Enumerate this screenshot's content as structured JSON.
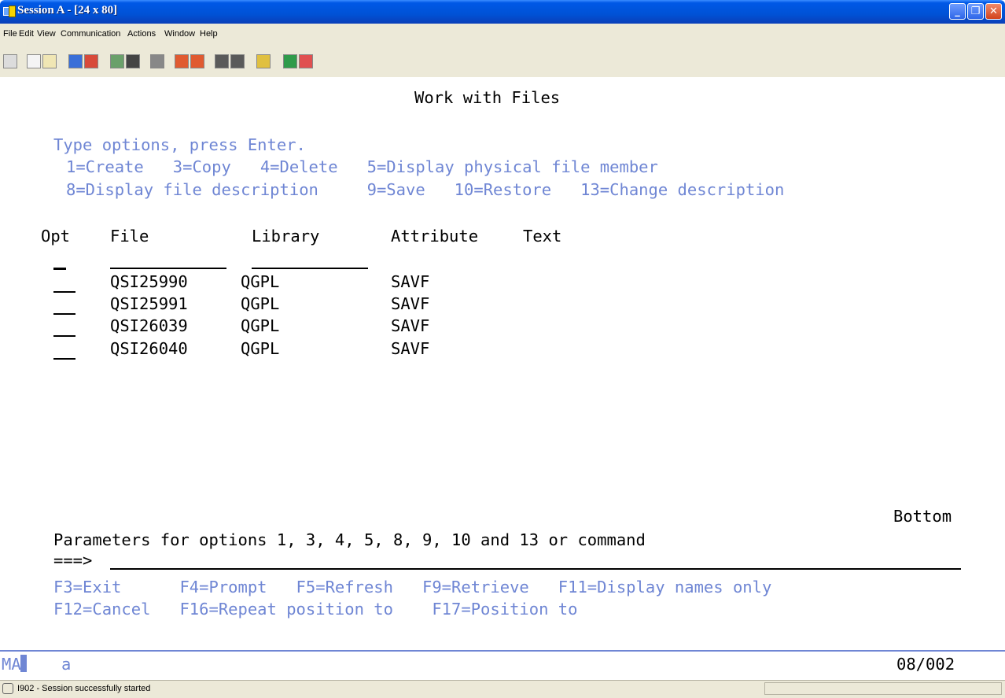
{
  "window": {
    "title": "Session A - [24 x 80]",
    "buttons": [
      "_",
      "❐",
      "✕"
    ]
  },
  "menu": [
    "File",
    "Edit",
    "View",
    "Communication",
    "Actions",
    "Window",
    "Help"
  ],
  "screen": {
    "title": "Work with Files",
    "instructions": "Type options, press Enter.",
    "options_line1": "1=Create   3=Copy   4=Delete   5=Display physical file member",
    "options_line2": "8=Display file description     9=Save   10=Restore   13=Change description",
    "headers": {
      "opt": "Opt",
      "file": "File",
      "library": "Library",
      "attribute": "Attribute",
      "text": "Text"
    },
    "rows": [
      {
        "file": "QSI25990",
        "library": "QGPL",
        "attribute": "SAVF"
      },
      {
        "file": "QSI25991",
        "library": "QGPL",
        "attribute": "SAVF"
      },
      {
        "file": "QSI26039",
        "library": "QGPL",
        "attribute": "SAVF"
      },
      {
        "file": "QSI26040",
        "library": "QGPL",
        "attribute": "SAVF"
      }
    ],
    "bottom": "Bottom",
    "params": "Parameters for options 1, 3, 4, 5, 8, 9, 10 and 13 or command",
    "prompt": "===>",
    "fkeys1": "F3=Exit      F4=Prompt   F5=Refresh   F9=Retrieve   F11=Display names only",
    "fkeys2": "F12=Cancel   F16=Repeat position to    F17=Position to"
  },
  "status": {
    "mode": "MA",
    "indicator": "a",
    "cursor": "08/002",
    "message": "I902 - Session successfully started"
  },
  "colors": {
    "field_text": "#6f86d4",
    "title_bar": "#0052d6"
  }
}
